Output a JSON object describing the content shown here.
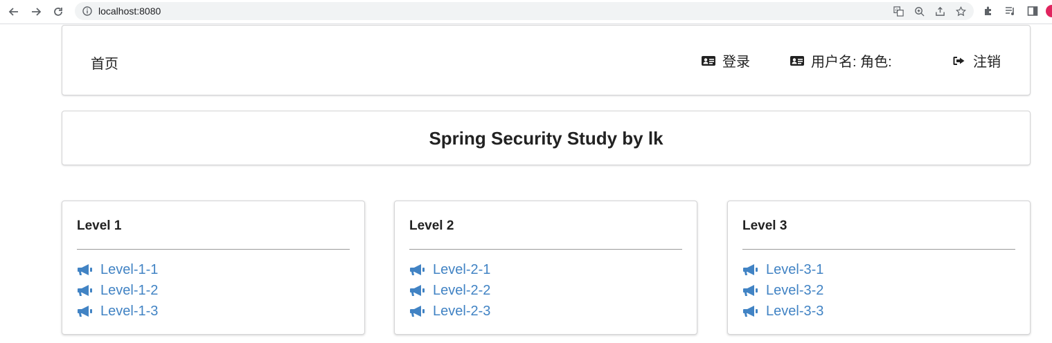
{
  "browser": {
    "url": "localhost:8080"
  },
  "header": {
    "home_label": "首页",
    "login_label": "登录",
    "user_label": "用户名: 角色:",
    "logout_label": "注销"
  },
  "title": "Spring Security Study by lk",
  "cards": [
    {
      "title": "Level 1",
      "links": [
        "Level-1-1",
        "Level-1-2",
        "Level-1-3"
      ]
    },
    {
      "title": "Level 2",
      "links": [
        "Level-2-1",
        "Level-2-2",
        "Level-2-3"
      ]
    },
    {
      "title": "Level 3",
      "links": [
        "Level-3-1",
        "Level-3-2",
        "Level-3-3"
      ]
    }
  ],
  "colors": {
    "link": "#4183c4",
    "text": "#222222",
    "border": "#d4d4d5"
  },
  "icons": {
    "menu_login": "id-card-icon",
    "menu_user": "id-card-icon",
    "menu_logout": "sign-out-icon",
    "card_link": "bullhorn-icon"
  }
}
